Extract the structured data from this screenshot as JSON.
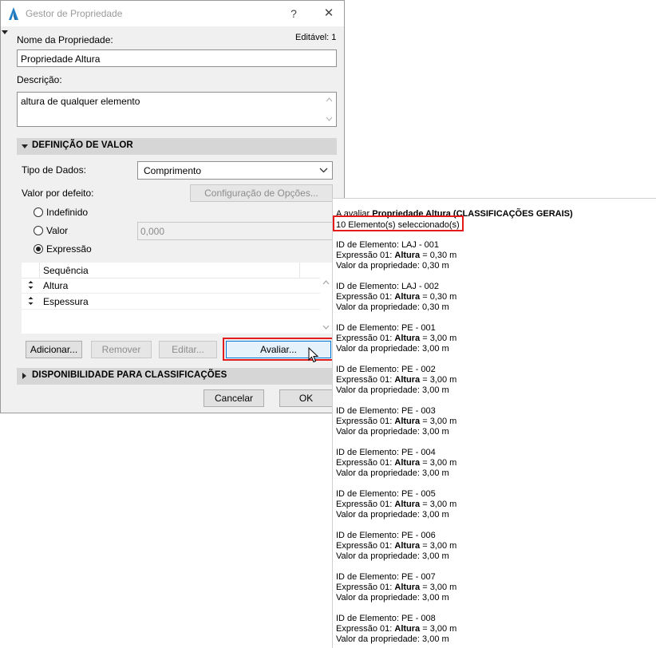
{
  "dialog": {
    "title": "Gestor de Propriedade",
    "help_label": "?",
    "close_label": "✕"
  },
  "name": {
    "label": "Nome da Propriedade:",
    "editable": "Editável: 1",
    "value": "Propriedade Altura"
  },
  "description": {
    "label": "Descrição:",
    "value": "altura de qualquer elemento"
  },
  "value_definition": {
    "header": "DEFINIÇÃO DE VALOR",
    "data_type_label": "Tipo de Dados:",
    "data_type_value": "Comprimento",
    "default_label": "Valor por defeito:",
    "options_button": "Configuração de Opções...",
    "radio_undefined": "Indefinido",
    "radio_value": "Valor",
    "value_field": "0,000",
    "radio_expression": "Expressão",
    "selected_radio": "Expressão"
  },
  "expression_list": {
    "header": "Sequência",
    "rows": [
      "Altura",
      "Espessura"
    ]
  },
  "buttons": {
    "add": "Adicionar...",
    "remove": "Remover",
    "edit": "Editar...",
    "evaluate": "Avaliar..."
  },
  "availability": {
    "header": "DISPONIBILIDADE PARA CLASSIFICAÇÕES"
  },
  "footer": {
    "cancel": "Cancelar",
    "ok": "OK"
  },
  "result": {
    "heading_prefix": "A avaliar ",
    "heading_bold": "Propriedade Altura (CLASSIFICAÇÕES GERAIS)",
    "selected": "10 Elemento(s) seleccionado(s)",
    "id_prefix": "ID de Elemento: ",
    "expr_prefix": "Expressão 01: ",
    "expr_bold": "Altura",
    "value_prefix": "Valor da propriedade: ",
    "elements": [
      {
        "id": "LAJ - 001",
        "expr": " = 0,30 m",
        "value": "0,30 m"
      },
      {
        "id": "LAJ - 002",
        "expr": " = 0,30 m",
        "value": "0,30 m"
      },
      {
        "id": "PE - 001",
        "expr": " = 3,00 m",
        "value": "3,00 m"
      },
      {
        "id": "PE - 002",
        "expr": " = 3,00 m",
        "value": "3,00 m"
      },
      {
        "id": "PE - 003",
        "expr": " = 3,00 m",
        "value": "3,00 m"
      },
      {
        "id": "PE - 004",
        "expr": " = 3,00 m",
        "value": "3,00 m"
      },
      {
        "id": "PE - 005",
        "expr": " = 3,00 m",
        "value": "3,00 m"
      },
      {
        "id": "PE - 006",
        "expr": " = 3,00 m",
        "value": "3,00 m"
      },
      {
        "id": "PE - 007",
        "expr": " = 3,00 m",
        "value": "3,00 m"
      },
      {
        "id": "PE - 008",
        "expr": " = 3,00 m",
        "value": "3,00 m"
      }
    ]
  },
  "colors": {
    "highlight": "#e31b1b",
    "accent": "#1f80c8",
    "evaluate_bg": "#e5f1fb"
  },
  "icons": {
    "app": "archicad-logo-icon",
    "cursor": "mouse-pointer-icon"
  }
}
